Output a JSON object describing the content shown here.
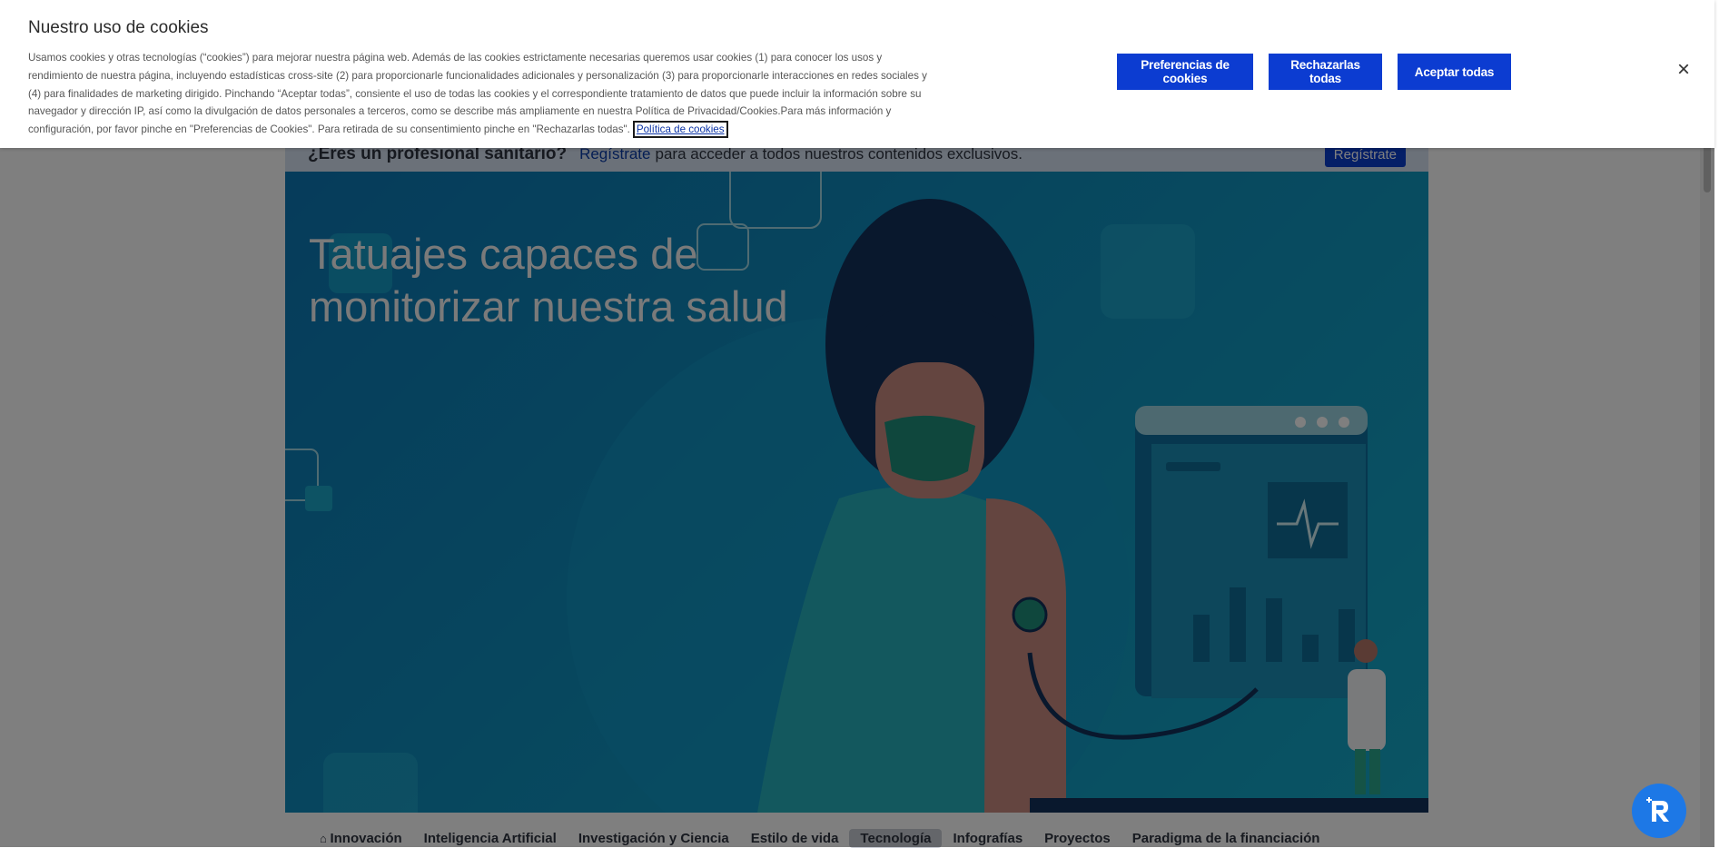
{
  "cookie_banner": {
    "title": "Nuestro uso de cookies",
    "body": "Usamos cookies y otras tecnologías (“cookies”) para mejorar nuestra página web. Además de las cookies estrictamente necesarias queremos usar cookies (1) para conocer los usos y rendimiento de nuestra página, incluyendo estadísticas cross-site (2) para proporcionarle funcionalidades adicionales y personalización (3) para proporcionarle interacciones en redes sociales y (4) para finalidades de marketing dirigido. Pinchando “Aceptar todas”, consiente el uso de todas las cookies y el correspondiente tratamiento de datos que puede incluir la información sobre su navegador y dirección IP, así como la divulgación de datos personales a terceros, como se describe más ampliamente en nuestra Política de Privacidad/Cookies.Para más información y configuración, por favor pinche en \"Preferencias de Cookies\". Para retirada de su consentimiento pinche en \"Rechazarlas todas\".",
    "policy_link": "Política de cookies",
    "buttons": {
      "preferences": "Preferencias de cookies",
      "reject_all": "Rechazarlas todas",
      "accept_all": "Aceptar todas"
    },
    "close_icon": "×"
  },
  "pro_bar": {
    "question": "¿Eres un profesional sanitario?",
    "register_link": "Regístrate",
    "rest": "para acceder a todos nuestros contenidos exclusivos.",
    "register_button": "Regístrate"
  },
  "hero": {
    "title": "Tatuajes capaces de monitorizar nuestra salud"
  },
  "nav": {
    "items": [
      {
        "label": "Innovación",
        "icon": "home-icon"
      },
      {
        "label": "Inteligencia Artificial"
      },
      {
        "label": "Investigación y Ciencia"
      },
      {
        "label": "Estilo de vida"
      },
      {
        "label": "Tecnología",
        "active": true
      },
      {
        "label": "Infografías"
      },
      {
        "label": "Proyectos"
      },
      {
        "label": "Paradigma de la financiación"
      }
    ]
  },
  "assistant_icon": "accessibility-assistant-icon",
  "colors": {
    "button_blue": "#0c3cd1",
    "hero_teal": "#0f8fbd"
  }
}
